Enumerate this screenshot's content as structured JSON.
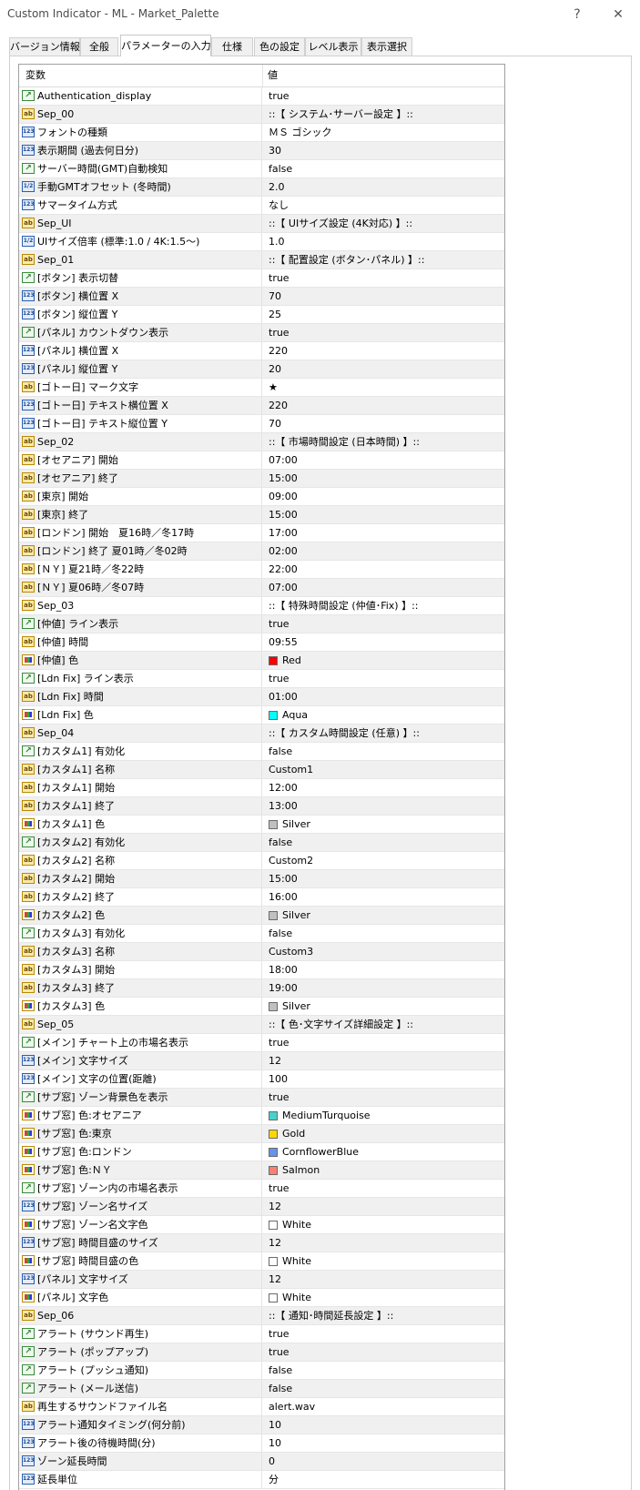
{
  "window": {
    "title": "Custom Indicator - ML - Market_Palette",
    "help_glyph": "?",
    "close_glyph": "✕"
  },
  "tabs": [
    {
      "label": "バージョン情報"
    },
    {
      "label": "全般"
    },
    {
      "label": "パラメーターの入力"
    },
    {
      "label": "仕様"
    },
    {
      "label": "色の設定"
    },
    {
      "label": "レベル表示"
    },
    {
      "label": "表示選択"
    }
  ],
  "grid": {
    "header": {
      "variable": "変数",
      "value": "値"
    },
    "rows": [
      {
        "type": "bool",
        "name": "Authentication_display",
        "value": "true"
      },
      {
        "type": "str",
        "name": "Sep_00",
        "value": "::【 システム･サーバー設定 】::"
      },
      {
        "type": "int",
        "name": "フォントの種類",
        "value": "ＭＳ ゴシック"
      },
      {
        "type": "int",
        "name": "表示期間 (過去何日分)",
        "value": "30"
      },
      {
        "type": "bool",
        "name": "サーバー時間(GMT)自動検知",
        "value": "false"
      },
      {
        "type": "dbl",
        "name": "手動GMTオフセット (冬時間)",
        "value": "2.0"
      },
      {
        "type": "int",
        "name": "サマータイム方式",
        "value": "なし"
      },
      {
        "type": "str",
        "name": "Sep_UI",
        "value": "::【 UIサイズ設定 (4K対応) 】::"
      },
      {
        "type": "dbl",
        "name": "UIサイズ倍率 (標準:1.0 / 4K:1.5～)",
        "value": "1.0"
      },
      {
        "type": "str",
        "name": "Sep_01",
        "value": "::【 配置設定 (ボタン･パネル) 】::"
      },
      {
        "type": "bool",
        "name": "[ボタン] 表示切替",
        "value": "true"
      },
      {
        "type": "int",
        "name": "[ボタン] 横位置 X",
        "value": "70"
      },
      {
        "type": "int",
        "name": "[ボタン] 縦位置 Y",
        "value": "25"
      },
      {
        "type": "bool",
        "name": "[パネル] カウントダウン表示",
        "value": "true"
      },
      {
        "type": "int",
        "name": "[パネル] 横位置 X",
        "value": "220"
      },
      {
        "type": "int",
        "name": "[パネル] 縦位置 Y",
        "value": "20"
      },
      {
        "type": "str",
        "name": "[ゴトー日] マーク文字",
        "value": "★"
      },
      {
        "type": "int",
        "name": "[ゴトー日] テキスト横位置 X",
        "value": "220"
      },
      {
        "type": "int",
        "name": "[ゴトー日] テキスト縦位置 Y",
        "value": "70"
      },
      {
        "type": "str",
        "name": "Sep_02",
        "value": "::【 市場時間設定 (日本時間) 】::"
      },
      {
        "type": "str",
        "name": "[オセアニア] 開始",
        "value": "07:00"
      },
      {
        "type": "str",
        "name": "[オセアニア] 終了",
        "value": "15:00"
      },
      {
        "type": "str",
        "name": "[東京] 開始",
        "value": "09:00"
      },
      {
        "type": "str",
        "name": "[東京] 終了",
        "value": "15:00"
      },
      {
        "type": "str",
        "name": "[ロンドン] 開始　夏16時／冬17時",
        "value": "17:00"
      },
      {
        "type": "str",
        "name": "[ロンドン] 終了 夏01時／冬02時",
        "value": "02:00"
      },
      {
        "type": "str",
        "name": "[ＮＹ] 夏21時／冬22時",
        "value": "22:00"
      },
      {
        "type": "str",
        "name": "[ＮＹ] 夏06時／冬07時",
        "value": "07:00"
      },
      {
        "type": "str",
        "name": "Sep_03",
        "value": "::【 特殊時間設定 (仲値･Fix) 】::"
      },
      {
        "type": "bool",
        "name": "[仲値] ライン表示",
        "value": "true"
      },
      {
        "type": "str",
        "name": "[仲値] 時間",
        "value": "09:55"
      },
      {
        "type": "col",
        "name": "[仲値] 色",
        "value": "Red",
        "swatch": "#ff0000"
      },
      {
        "type": "bool",
        "name": "[Ldn Fix] ライン表示",
        "value": "true"
      },
      {
        "type": "str",
        "name": "[Ldn Fix] 時間",
        "value": "01:00"
      },
      {
        "type": "col",
        "name": "[Ldn Fix] 色",
        "value": "Aqua",
        "swatch": "#00ffff"
      },
      {
        "type": "str",
        "name": "Sep_04",
        "value": "::【 カスタム時間設定 (任意) 】::"
      },
      {
        "type": "bool",
        "name": "[カスタム1] 有効化",
        "value": "false"
      },
      {
        "type": "str",
        "name": "[カスタム1] 名称",
        "value": "Custom1"
      },
      {
        "type": "str",
        "name": "[カスタム1] 開始",
        "value": "12:00"
      },
      {
        "type": "str",
        "name": "[カスタム1] 終了",
        "value": "13:00"
      },
      {
        "type": "col",
        "name": "[カスタム1] 色",
        "value": "Silver",
        "swatch": "#c0c0c0"
      },
      {
        "type": "bool",
        "name": "[カスタム2] 有効化",
        "value": "false"
      },
      {
        "type": "str",
        "name": "[カスタム2] 名称",
        "value": "Custom2"
      },
      {
        "type": "str",
        "name": "[カスタム2] 開始",
        "value": "15:00"
      },
      {
        "type": "str",
        "name": "[カスタム2] 終了",
        "value": "16:00"
      },
      {
        "type": "col",
        "name": "[カスタム2] 色",
        "value": "Silver",
        "swatch": "#c0c0c0"
      },
      {
        "type": "bool",
        "name": "[カスタム3] 有効化",
        "value": "false"
      },
      {
        "type": "str",
        "name": "[カスタム3] 名称",
        "value": "Custom3"
      },
      {
        "type": "str",
        "name": "[カスタム3] 開始",
        "value": "18:00"
      },
      {
        "type": "str",
        "name": "[カスタム3] 終了",
        "value": "19:00"
      },
      {
        "type": "col",
        "name": "[カスタム3] 色",
        "value": "Silver",
        "swatch": "#c0c0c0"
      },
      {
        "type": "str",
        "name": "Sep_05",
        "value": "::【 色･文字サイズ詳細設定 】::"
      },
      {
        "type": "bool",
        "name": "[メイン] チャート上の市場名表示",
        "value": "true"
      },
      {
        "type": "int",
        "name": "[メイン] 文字サイズ",
        "value": "12"
      },
      {
        "type": "int",
        "name": "[メイン] 文字の位置(距離)",
        "value": "100"
      },
      {
        "type": "bool",
        "name": "[サブ窓] ゾーン背景色を表示",
        "value": "true"
      },
      {
        "type": "col",
        "name": "[サブ窓] 色:オセアニア",
        "value": "MediumTurquoise",
        "swatch": "#48d1cc"
      },
      {
        "type": "col",
        "name": "[サブ窓] 色:東京",
        "value": "Gold",
        "swatch": "#ffd700"
      },
      {
        "type": "col",
        "name": "[サブ窓] 色:ロンドン",
        "value": "CornflowerBlue",
        "swatch": "#6495ed"
      },
      {
        "type": "col",
        "name": "[サブ窓] 色:ＮＹ",
        "value": "Salmon",
        "swatch": "#fa8072"
      },
      {
        "type": "bool",
        "name": "[サブ窓] ゾーン内の市場名表示",
        "value": "true"
      },
      {
        "type": "int",
        "name": "[サブ窓] ゾーン名サイズ",
        "value": "12"
      },
      {
        "type": "col",
        "name": "[サブ窓] ゾーン名文字色",
        "value": "White",
        "swatch": "#ffffff"
      },
      {
        "type": "int",
        "name": "[サブ窓] 時間目盛のサイズ",
        "value": "12"
      },
      {
        "type": "col",
        "name": "[サブ窓] 時間目盛の色",
        "value": "White",
        "swatch": "#ffffff"
      },
      {
        "type": "int",
        "name": "[パネル] 文字サイズ",
        "value": "12"
      },
      {
        "type": "col",
        "name": "[パネル] 文字色",
        "value": "White",
        "swatch": "#ffffff"
      },
      {
        "type": "str",
        "name": "Sep_06",
        "value": "::【 通知･時間延長設定 】::"
      },
      {
        "type": "bool",
        "name": "アラート (サウンド再生)",
        "value": "true"
      },
      {
        "type": "bool",
        "name": "アラート (ポップアップ)",
        "value": "true"
      },
      {
        "type": "bool",
        "name": "アラート (プッシュ通知)",
        "value": "false"
      },
      {
        "type": "bool",
        "name": "アラート (メール送信)",
        "value": "false"
      },
      {
        "type": "str",
        "name": "再生するサウンドファイル名",
        "value": "alert.wav"
      },
      {
        "type": "int",
        "name": "アラート通知タイミング(何分前)",
        "value": "10"
      },
      {
        "type": "int",
        "name": "アラート後の待機時間(分)",
        "value": "10"
      },
      {
        "type": "int",
        "name": "ゾーン延長時間",
        "value": "0"
      },
      {
        "type": "int",
        "name": "延長単位",
        "value": "分"
      }
    ]
  },
  "type_icons": {
    "bool": {
      "glyph": "↗",
      "icon": "bool-type-icon"
    },
    "str": {
      "glyph": "ab",
      "icon": "string-type-icon"
    },
    "int": {
      "glyph": "123",
      "icon": "integer-type-icon"
    },
    "dbl": {
      "glyph": "1/2",
      "icon": "double-type-icon"
    },
    "col": {
      "glyph": "",
      "icon": "color-type-icon"
    }
  }
}
